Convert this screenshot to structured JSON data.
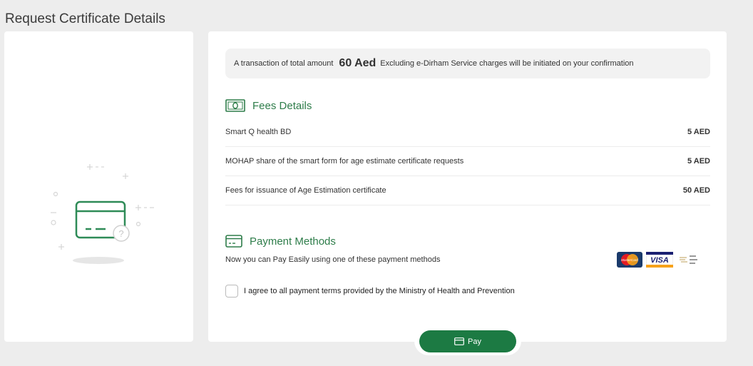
{
  "page": {
    "title": "Request Certificate Details"
  },
  "banner": {
    "prefix": "A transaction of total amount",
    "amount": "60 Aed",
    "suffix": "Excluding e-Dirham Service charges will be initiated on your confirmation"
  },
  "fees": {
    "title": "Fees Details",
    "icon": "money-bill-icon",
    "items": [
      {
        "label": "Smart Q health BD",
        "value": "5 AED"
      },
      {
        "label": "MOHAP share of the smart form for age estimate certificate requests",
        "value": "5 AED"
      },
      {
        "label": "Fees for issuance of Age Estimation certificate",
        "value": "50 AED"
      }
    ]
  },
  "payment": {
    "title": "Payment Methods",
    "icon": "credit-card-icon",
    "subtitle": "Now you can Pay Easily using one of these payment methods",
    "logos": [
      "mastercard-logo",
      "visa-logo",
      "edirham-logo"
    ],
    "mastercard_text": "MasterCard",
    "visa_text": "VISA"
  },
  "agreement": {
    "label": "I agree to all payment terms provided by the Ministry of Health and Prevention",
    "checked": false
  },
  "pay_button": {
    "label": "Pay",
    "icon": "credit-card-icon"
  },
  "colors": {
    "accent": "#1c7a43",
    "heading_green": "#2e7d4a",
    "background": "#ededed"
  }
}
